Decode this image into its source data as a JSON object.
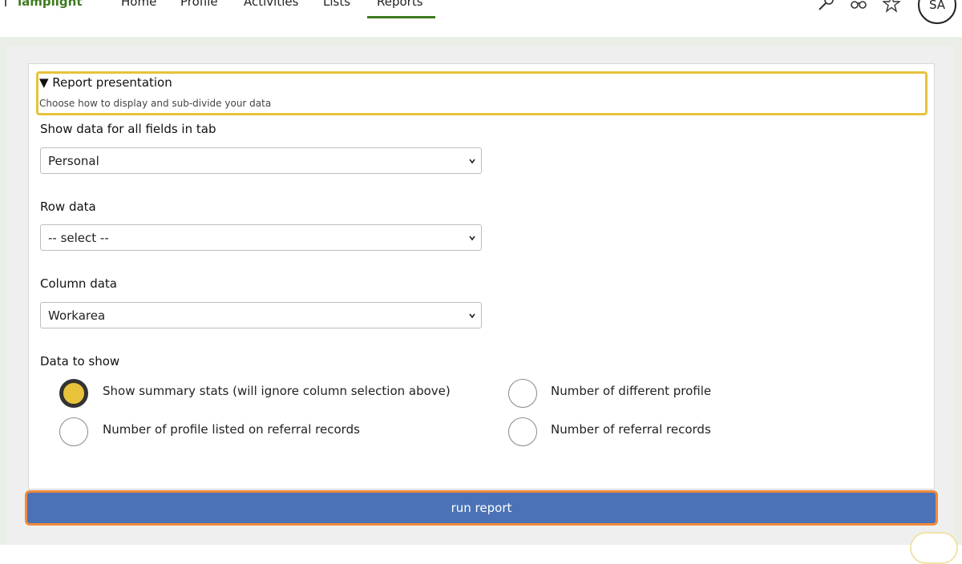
{
  "app": {
    "logo_text": "lamplight"
  },
  "nav": {
    "items": [
      "Home",
      "Profile",
      "Activities",
      "Lists",
      "Reports"
    ],
    "active": "Reports"
  },
  "top_icons": [
    "magnifier-icon",
    "binoculars-icon",
    "star-icon"
  ],
  "user": {
    "initials": "SA"
  },
  "section": {
    "title": "▼ Report presentation",
    "subtitle": "Choose how to display and sub-divide your data"
  },
  "fields": {
    "tab_label": "Show data for all fields in tab",
    "tab_value": "Personal",
    "row_label": "Row data",
    "row_value": "-- select --",
    "column_label": "Column data",
    "column_value": "Workarea",
    "data_label": "Data to show"
  },
  "options": [
    {
      "label": "Show summary stats (will ignore column selection above)",
      "checked": true
    },
    {
      "label": "Number of different profile",
      "checked": false
    },
    {
      "label": "Number of profile listed on referral records",
      "checked": false
    },
    {
      "label": "Number of referral records",
      "checked": false
    }
  ],
  "actions": {
    "run_label": "run report"
  },
  "colors": {
    "brand": "#3f7a1f",
    "highlight": "#e8c23a",
    "button": "#4b72b6",
    "button_focus": "#f08a3c"
  }
}
